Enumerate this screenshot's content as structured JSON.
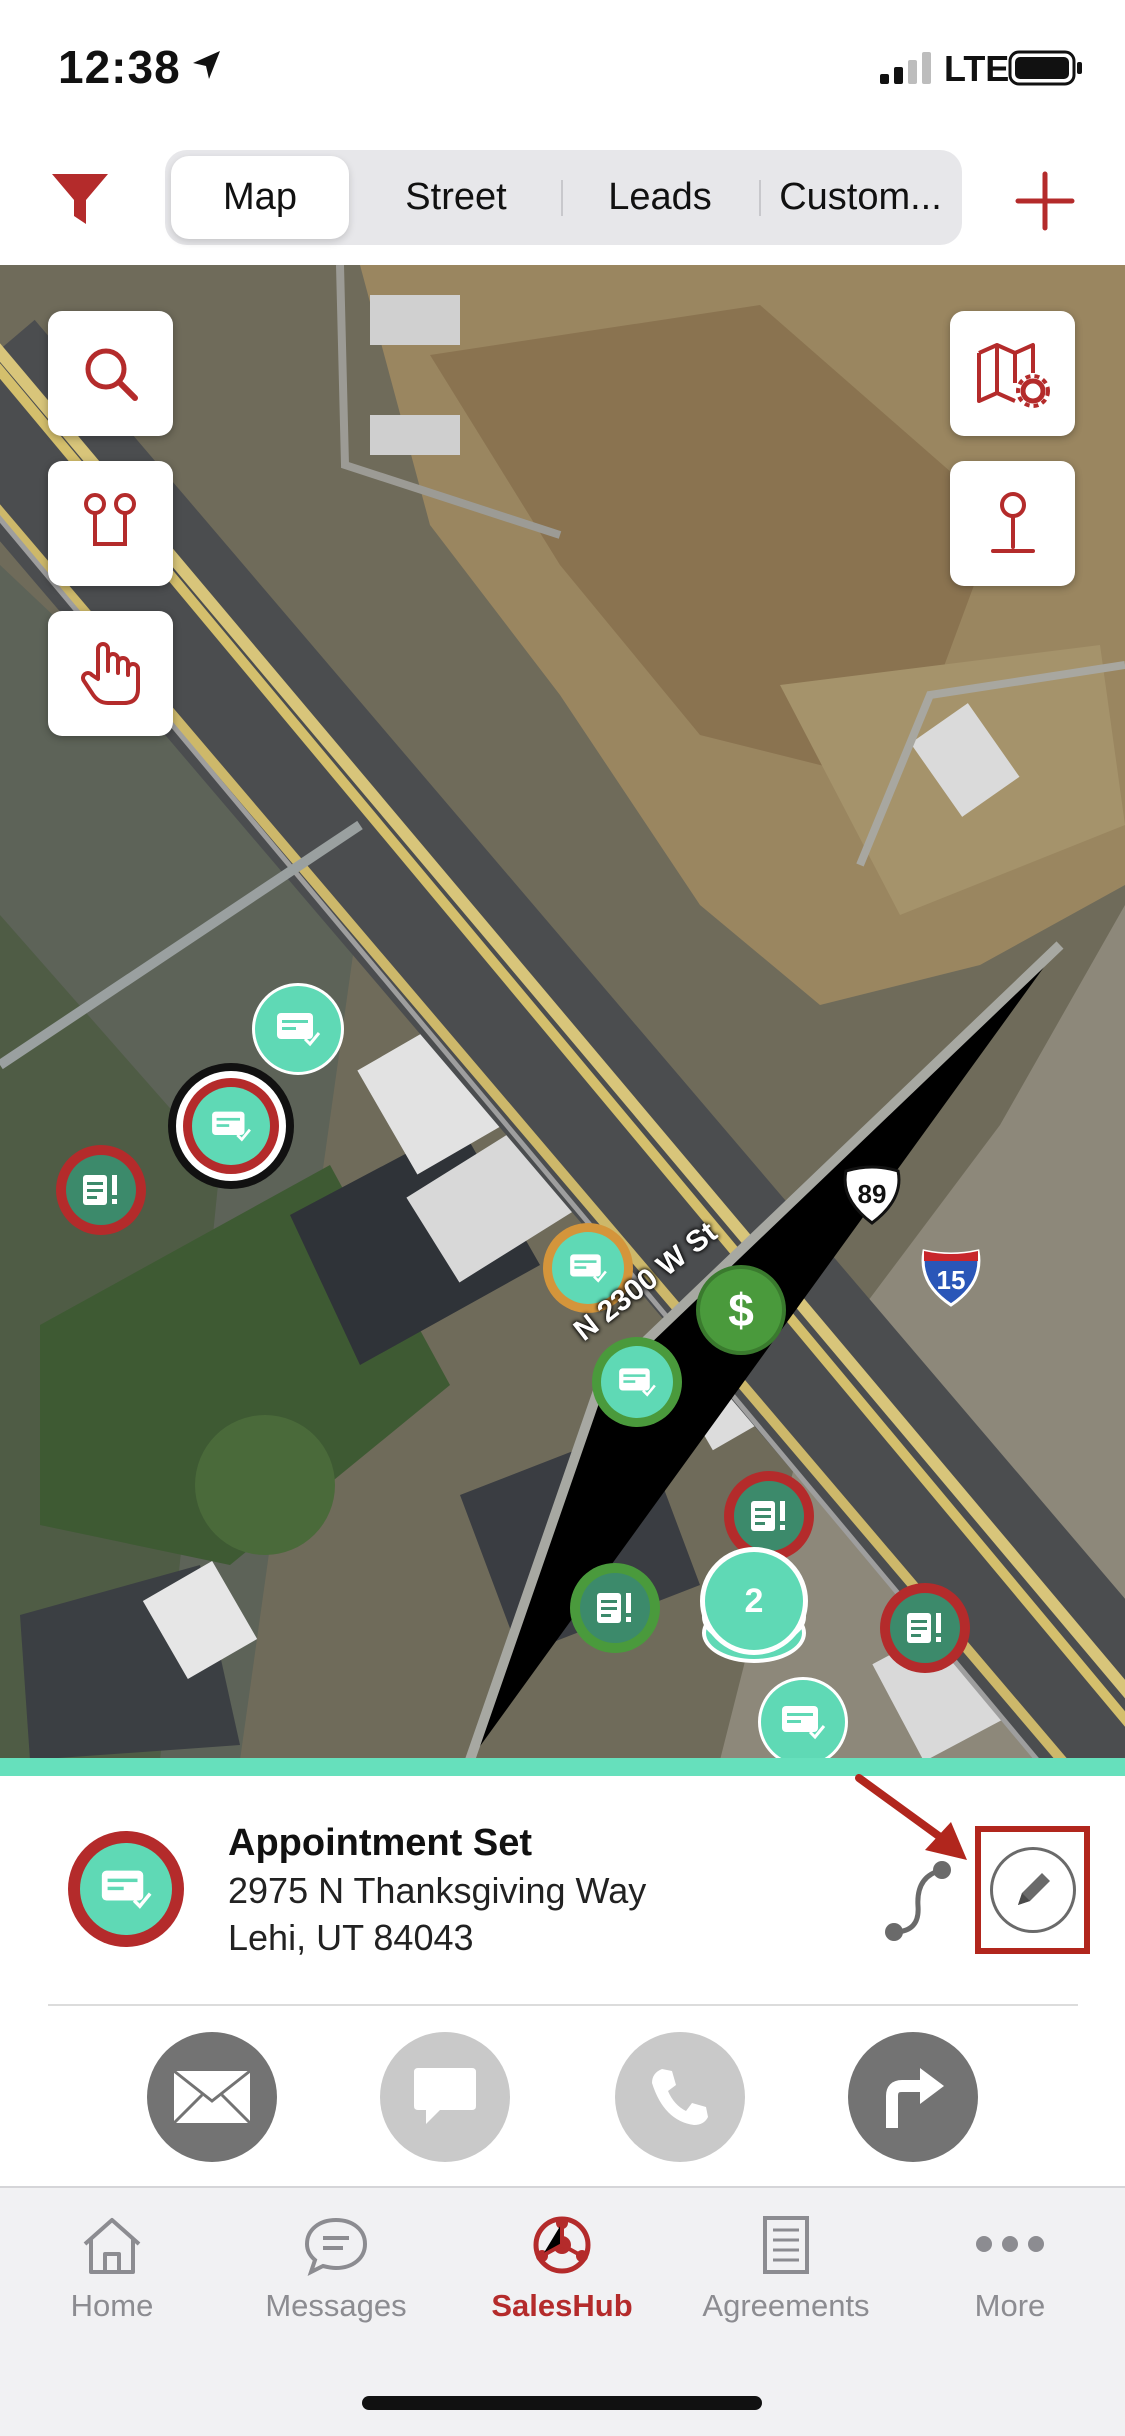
{
  "status_bar": {
    "time": "12:38",
    "network": "LTE"
  },
  "top_bar": {
    "tabs": [
      {
        "label": "Map",
        "active": true
      },
      {
        "label": "Street",
        "active": false
      },
      {
        "label": "Leads",
        "active": false
      },
      {
        "label": "Custom...",
        "active": false
      }
    ]
  },
  "map": {
    "road_label": "N 2300 W St",
    "shield_us": "89",
    "shield_interstate": "15",
    "cluster_count": "2"
  },
  "detail": {
    "status": "Appointment Set",
    "address_line1": "2975 N Thanksgiving Way",
    "address_line2": "Lehi, UT 84043"
  },
  "tab_bar": {
    "items": [
      {
        "label": "Home",
        "icon": "home-icon"
      },
      {
        "label": "Messages",
        "icon": "messages-icon"
      },
      {
        "label": "SalesHub",
        "icon": "saleshub-icon",
        "active": true
      },
      {
        "label": "Agreements",
        "icon": "agreements-icon"
      },
      {
        "label": "More",
        "icon": "more-icon"
      }
    ]
  },
  "colors": {
    "brand_red": "#b42b2b",
    "accent_teal": "#5fd9b5",
    "pin_green": "#4a9a3c",
    "pin_orange": "#d4953b"
  }
}
